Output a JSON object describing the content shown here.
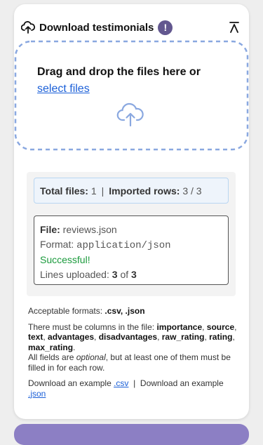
{
  "colors": {
    "accent": "#62578f",
    "link": "#1a5fd8",
    "success": "#1a9a3c",
    "dropzone_border": "#8aa8e0",
    "bottom_bar": "#8c7fc4"
  },
  "header": {
    "title": "Download testimonials",
    "alert_glyph": "!",
    "icons": [
      "cloud-upload-icon",
      "alert-icon",
      "collapse-icon"
    ]
  },
  "dropzone": {
    "text": "Drag and drop the files here or",
    "link": "select files",
    "icon": "cloud-upload-icon"
  },
  "summary": {
    "total_label": "Total files:",
    "total_value": "1",
    "separator": "|",
    "imported_label": "Imported rows:",
    "imported_value": "3 / 3"
  },
  "file": {
    "name_label": "File:",
    "name_value": "reviews.json",
    "format_label": "Format:",
    "format_value": "application/json",
    "status": "Successful!",
    "lines_label": "Lines uploaded:",
    "lines_uploaded": "3",
    "lines_of": "of",
    "lines_total": "3"
  },
  "info": {
    "formats_prefix": "Acceptable formats:",
    "formats_value": ".csv, .json",
    "columns_prefix": "There must be columns in the file:",
    "columns": [
      "importance",
      "source",
      "text",
      "advantages",
      "disadvantages",
      "raw_rating",
      "rating",
      "max_rating"
    ],
    "optional_1": "All fields are",
    "optional_em": "optional",
    "optional_2": ", but at least one of them must be filled in for each row.",
    "example_label": "Download an example",
    "example_csv": ".csv",
    "example_separator": "|",
    "example_json": ".json"
  }
}
